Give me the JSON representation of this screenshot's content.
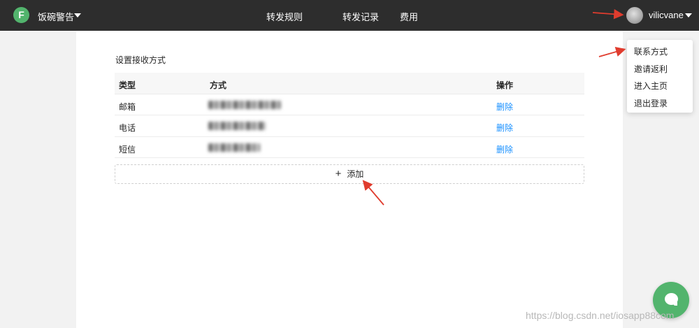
{
  "header": {
    "logo_letter": "F",
    "app_name": "饭碗警告",
    "nav": [
      "转发规则",
      "转发记录",
      "费用"
    ],
    "username": "vilicvane"
  },
  "main": {
    "title": "设置接收方式",
    "columns": [
      "类型",
      "方式",
      "操作"
    ],
    "rows": [
      {
        "type": "邮箱",
        "action": "删除"
      },
      {
        "type": "电话",
        "action": "删除"
      },
      {
        "type": "短信",
        "action": "删除"
      }
    ],
    "add_label": "添加"
  },
  "user_menu": [
    "联系方式",
    "邀请返利",
    "进入主页",
    "退出登录"
  ],
  "watermark": "https://blog.csdn.net/iosapp88com",
  "colors": {
    "brand_green": "#52b46d",
    "link_blue": "#1890ff",
    "annotation_red": "#e03c2e",
    "topbar": "#2d2d2d"
  }
}
